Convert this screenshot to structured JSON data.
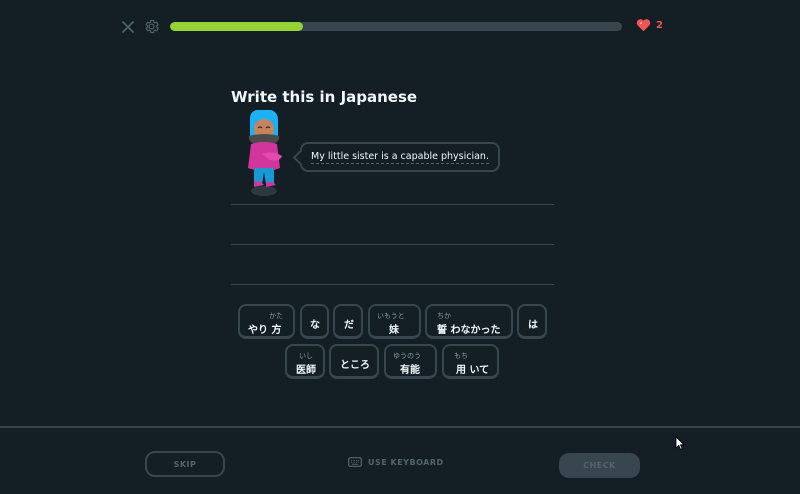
{
  "header": {
    "close_icon": "close-icon",
    "settings_icon": "gear-icon",
    "progress_fraction": 0.295,
    "progress_color": "#93d333",
    "hearts_icon": "heart-icon",
    "hearts_count": "2",
    "hearts_color": "#ee5555"
  },
  "prompt": {
    "title": "Write this in Japanese"
  },
  "bubble": {
    "text": "My little sister is a capable physician."
  },
  "word_bank": {
    "row1": [
      {
        "text": "やり 方",
        "ruby": "かた"
      },
      {
        "text": "な",
        "ruby": ""
      },
      {
        "text": "だ",
        "ruby": ""
      },
      {
        "text": "妹",
        "ruby": "いもうと"
      },
      {
        "text": "誓 わなかった",
        "ruby": "ちか"
      },
      {
        "text": "は",
        "ruby": ""
      }
    ],
    "row2": [
      {
        "text": "医師",
        "ruby": "いし"
      },
      {
        "text": "ところ",
        "ruby": ""
      },
      {
        "text": "有能",
        "ruby": "ゆうのう"
      },
      {
        "text": "用 いて",
        "ruby": "もち"
      }
    ]
  },
  "footer": {
    "skip_label": "SKIP",
    "keyboard_icon": "keyboard-icon",
    "keyboard_label": "USE KEYBOARD",
    "check_label": "CHECK"
  }
}
